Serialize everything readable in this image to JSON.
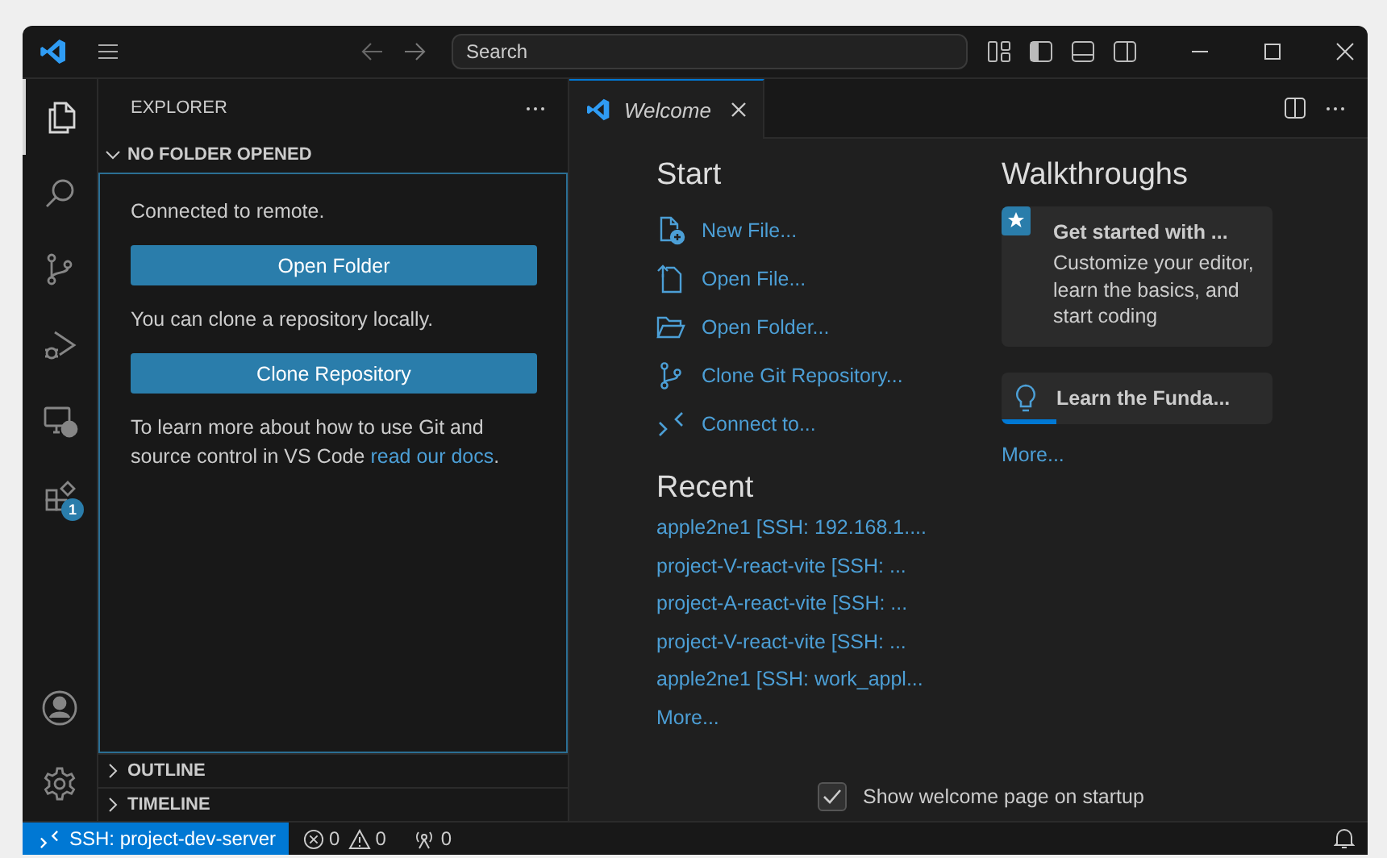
{
  "title_bar": {
    "search": {
      "placeholder": "Search"
    }
  },
  "activity_bar": {
    "items": [
      {
        "kind": "explorer",
        "selected": true
      },
      {
        "kind": "search",
        "selected": false
      },
      {
        "kind": "source-control",
        "selected": false
      },
      {
        "kind": "run-debug",
        "selected": false
      },
      {
        "kind": "remote",
        "selected": false
      },
      {
        "kind": "extensions",
        "selected": false,
        "badge": "1"
      }
    ],
    "bottom_items": [
      {
        "kind": "account"
      },
      {
        "kind": "settings"
      }
    ]
  },
  "sidebar": {
    "title": "EXPLORER",
    "section": {
      "title": "NO FOLDER OPENED",
      "expanded": true,
      "blocks": [
        {
          "kind": "text",
          "text": "Connected to remote."
        },
        {
          "kind": "button",
          "text": "Open Folder"
        },
        {
          "kind": "text",
          "text": "You can clone a repository locally."
        },
        {
          "kind": "button",
          "text": "Clone Repository"
        },
        {
          "kind": "paragraph",
          "text": "To learn more about how to use Git and source control in VS Code ",
          "link": "read our docs",
          "after": "."
        }
      ]
    },
    "collapsed_sections": [
      {
        "title": "OUTLINE",
        "expanded": false
      },
      {
        "title": "TIMELINE",
        "expanded": false
      }
    ]
  },
  "tabs": [
    {
      "label": "Welcome",
      "selected": true
    }
  ],
  "welcome": {
    "start": {
      "heading": "Start",
      "items": [
        {
          "kind": "new-file",
          "label": "New File..."
        },
        {
          "kind": "open-file",
          "label": "Open File..."
        },
        {
          "kind": "open-folder",
          "label": "Open Folder..."
        },
        {
          "kind": "clone",
          "label": "Clone Git Repository..."
        },
        {
          "kind": "connect",
          "label": "Connect to..."
        }
      ]
    },
    "recent": {
      "heading": "Recent",
      "items": [
        "apple2ne1 [SSH: 192.168.1....",
        "project-V-react-vite [SSH: ...",
        "project-A-react-vite [SSH: ...",
        "project-V-react-vite [SSH: ...",
        "apple2ne1 [SSH: work_appl..."
      ],
      "more": "More..."
    },
    "walkthroughs": {
      "heading": "Walkthroughs",
      "items": [
        {
          "kind": "featured",
          "title": "Get started with ...",
          "description": "Customize your editor, learn the basics, and start coding"
        },
        {
          "kind": "progress",
          "title": "Learn the Funda...",
          "level": 0.2
        }
      ],
      "more": "More..."
    },
    "show_on_startup": {
      "label": "Show welcome page on startup",
      "checked": true
    }
  },
  "status_bar": {
    "remote": "SSH: project-dev-server",
    "errors": "0",
    "warnings": "0",
    "ports": "0"
  }
}
